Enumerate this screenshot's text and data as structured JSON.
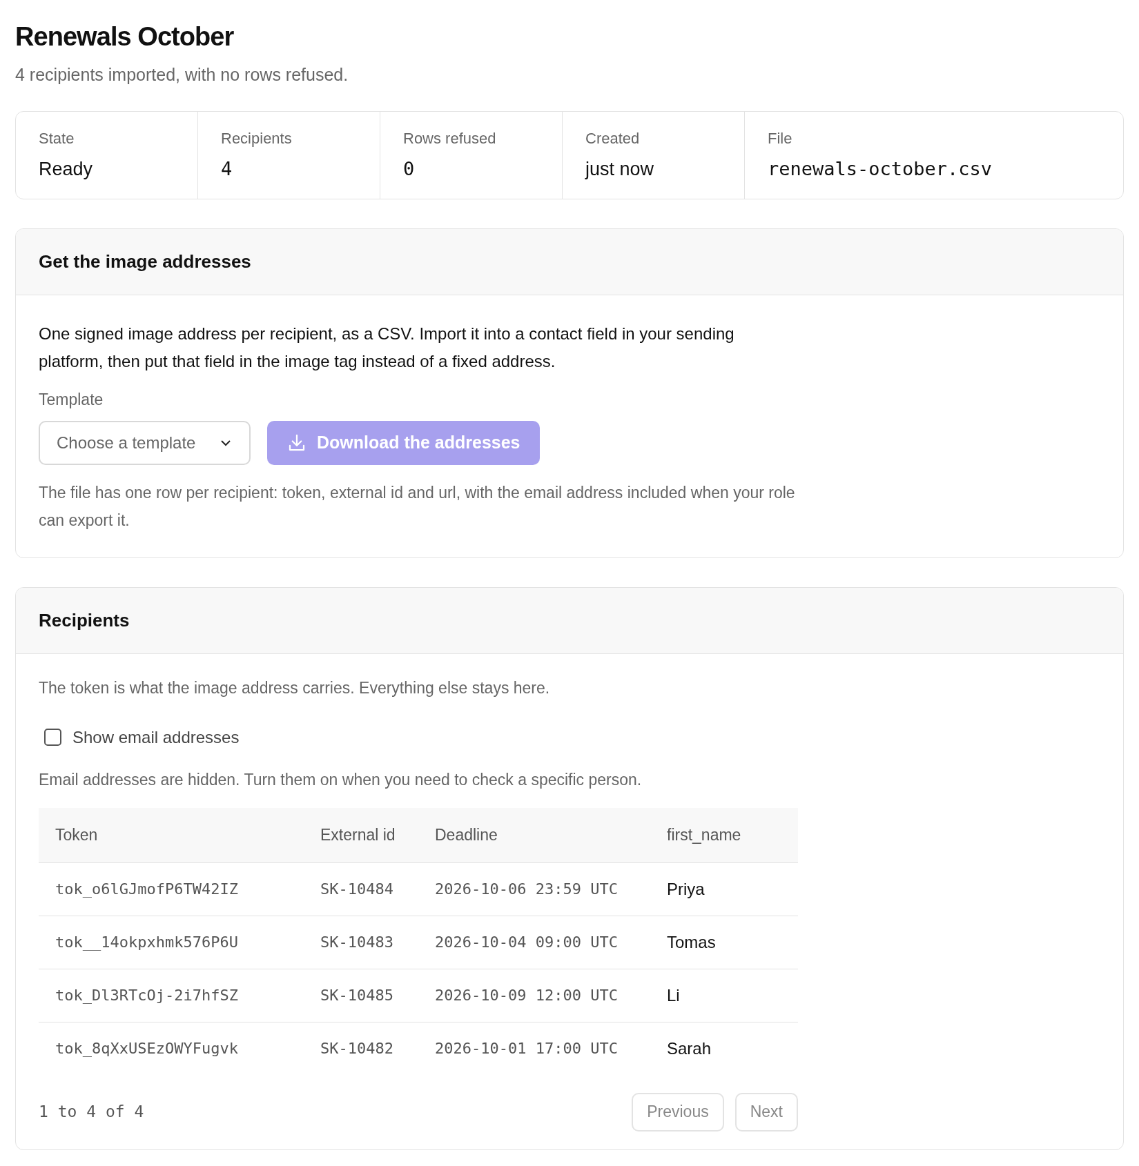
{
  "title": "Renewals October",
  "subtitle": "4 recipients imported, with no rows refused.",
  "stats": [
    {
      "label": "State",
      "value": "Ready",
      "kind": "text"
    },
    {
      "label": "Recipients",
      "value": "4",
      "kind": "mono"
    },
    {
      "label": "Rows refused",
      "value": "0",
      "kind": "mono"
    },
    {
      "label": "Created",
      "value": "just now",
      "kind": "text"
    },
    {
      "label": "File",
      "value": "renewals-october.csv",
      "kind": "mono"
    }
  ],
  "addresses": {
    "heading": "Get the image addresses",
    "description": "One signed image address per recipient, as a CSV. Import it into a contact field in your sending platform, then put that field in the image tag instead of a fixed address.",
    "template_label": "Template",
    "template_select": {
      "placeholder": "Choose a template"
    },
    "download_button": {
      "label": "Download the addresses",
      "disabled": true
    },
    "note": "The file has one row per recipient: token, external id and url, with the email address included when your role can export it."
  },
  "recipients": {
    "heading": "Recipients",
    "description": "The token is what the image address carries. Everything else stays here.",
    "show_emails": {
      "label": "Show email addresses",
      "checked": false
    },
    "hidden_note": "Email addresses are hidden. Turn them on when you need to check a specific person.",
    "table": {
      "columns": [
        "Token",
        "External id",
        "Deadline",
        "first_name"
      ],
      "rows": [
        [
          "tok_o6lGJmofP6TW42IZ",
          "SK-10484",
          "2026-10-06 23:59 UTC",
          "Priya"
        ],
        [
          "tok__14okpxhmk576P6U",
          "SK-10483",
          "2026-10-04 09:00 UTC",
          "Tomas"
        ],
        [
          "tok_Dl3RTcOj-2i7hfSZ",
          "SK-10485",
          "2026-10-09 12:00 UTC",
          "Li"
        ],
        [
          "tok_8qXxUSEzOWYFugvk",
          "SK-10482",
          "2026-10-01 17:00 UTC",
          "Sarah"
        ]
      ]
    },
    "pagination": {
      "summary": "1 to 4 of 4",
      "previous": "Previous",
      "next": "Next"
    }
  }
}
